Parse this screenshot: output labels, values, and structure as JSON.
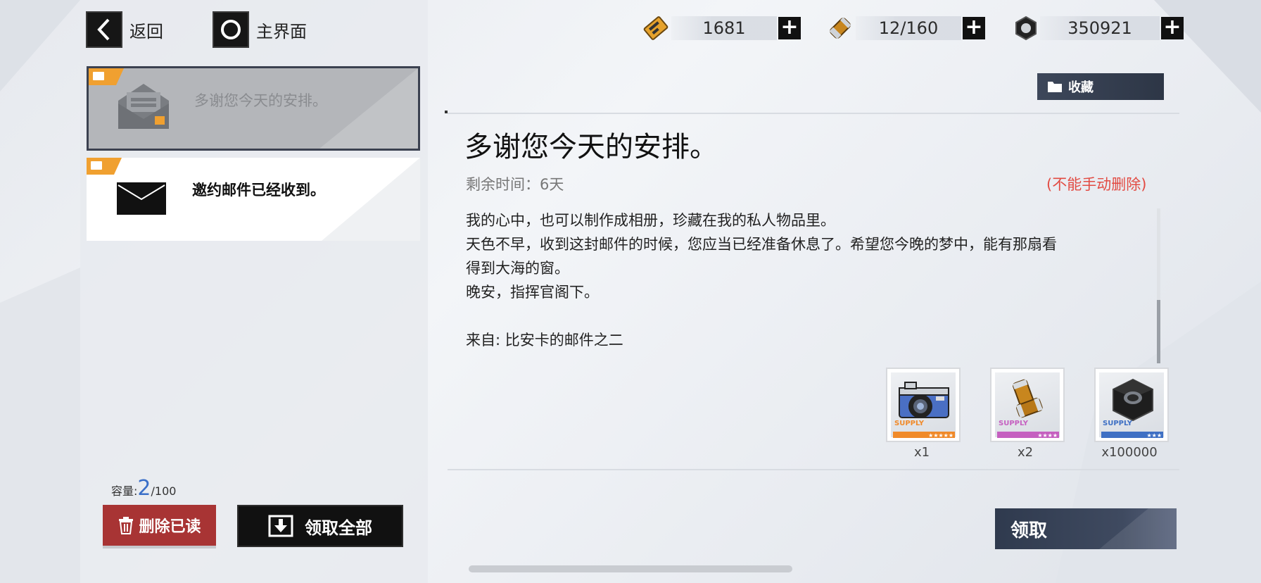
{
  "nav": {
    "back_label": "返回",
    "home_label": "主界面"
  },
  "resources": [
    {
      "icon": "ticket-icon",
      "value": "1681"
    },
    {
      "icon": "battery-icon",
      "value": "12/160"
    },
    {
      "icon": "hex-nut-icon",
      "value": "350921"
    }
  ],
  "mail_list": [
    {
      "title": "多谢您今天的安排。",
      "state": "opened"
    },
    {
      "title": "邀约邮件已经收到。",
      "state": "unread"
    }
  ],
  "capacity": {
    "label": "容量:",
    "count": "2",
    "max": "/100"
  },
  "buttons": {
    "delete_read": "删除已读",
    "claim_all": "领取全部",
    "favorite": "收藏",
    "claim": "领取"
  },
  "mail": {
    "title": "多谢您今天的安排。",
    "remaining": "剩余时间：6天",
    "no_delete": "(不能手动删除)",
    "lines": [
      "我的心中，也可以制作成相册，珍藏在我的私人物品里。",
      "天色不早，收到这封邮件的时候，您应当已经准备休息了。希望您今晚的梦中，能有那扇看",
      "得到大海的窗。",
      "晚安，指挥官阁下。",
      "",
      "来自: 比安卡的邮件之二"
    ]
  },
  "rewards": [
    {
      "icon": "camera-icon",
      "supply_label": "SUPPLY",
      "stars": "★★★★★",
      "color": "#f08a2a",
      "qty": "x1"
    },
    {
      "icon": "battery-icon",
      "supply_label": "SUPPLY",
      "stars": "★★★★",
      "color": "#c560c0",
      "qty": "x2"
    },
    {
      "icon": "hex-nut-icon",
      "supply_label": "SUPPLY",
      "stars": "★★★",
      "color": "#3f70c4",
      "qty": "x100000"
    }
  ]
}
